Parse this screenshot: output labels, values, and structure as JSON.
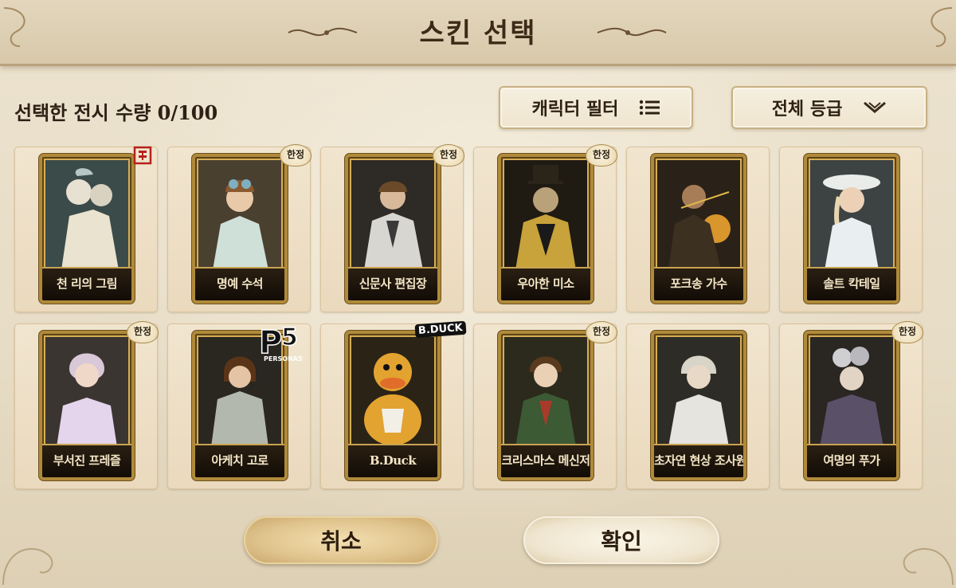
{
  "header": {
    "title": "스킨 선택"
  },
  "toolbar": {
    "selected_count": "선택한 전시 수량 0/100",
    "filter_label": "캐릭터 필터",
    "grade_label": "전체 등급"
  },
  "cards": [
    {
      "name": "천 리의 그림",
      "badge": ""
    },
    {
      "name": "명예 수석",
      "badge": "한정"
    },
    {
      "name": "신문사 편집장",
      "badge": "한정"
    },
    {
      "name": "우아한 미소",
      "badge": "한정"
    },
    {
      "name": "포크송 가수",
      "badge": ""
    },
    {
      "name": "솔트 칵테일",
      "badge": ""
    },
    {
      "name": "부서진 프레즐",
      "badge": "한정"
    },
    {
      "name": "아케치 고로",
      "badge": ""
    },
    {
      "name": "B.Duck",
      "badge": ""
    },
    {
      "name": "크리스마스 메신저",
      "badge": "한정"
    },
    {
      "name": "초자연 현상 조사원",
      "badge": ""
    },
    {
      "name": "여명의 푸가",
      "badge": "한정"
    }
  ],
  "collab": {
    "p5": "PERSONA5",
    "bduck": "B.DUCK"
  },
  "footer": {
    "cancel_label": "취소",
    "confirm_label": "확인"
  },
  "colors": {
    "frame_gold": "#b08a3a",
    "plate_text": "#f4e6c6",
    "title_text": "#3c2a17"
  }
}
